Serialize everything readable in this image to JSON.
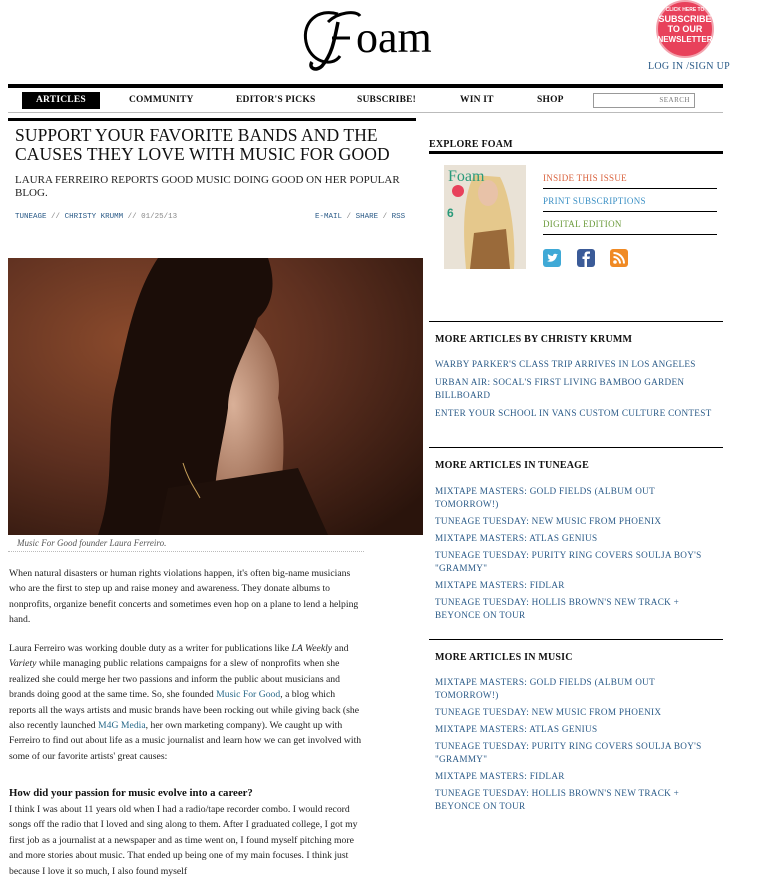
{
  "header": {
    "logo_text": "Foam",
    "newsletter_badge": [
      "CLICK HERE TO",
      "SUBSCRIBE",
      "TO OUR",
      "NEWSLETTER"
    ],
    "login_label": "LOG IN /SIGN UP"
  },
  "nav": {
    "items": [
      "ARTICLES",
      "COMMUNITY",
      "EDITOR'S PICKS",
      "SUBSCRIBE!",
      "WIN IT",
      "SHOP"
    ],
    "search_label": "SEARCH"
  },
  "article": {
    "title": "SUPPORT YOUR FAVORITE BANDS AND THE CAUSES THEY LOVE WITH MUSIC FOR GOOD",
    "subtitle": "LAURA FERREIRO REPORTS GOOD MUSIC DOING GOOD ON HER POPULAR BLOG.",
    "meta": {
      "category": "TUNEAGE",
      "author": "CHRISTY KRUMM",
      "date": "01/25/13",
      "sep": "//"
    },
    "actions": {
      "email": "E-MAIL",
      "share": "SHARE",
      "rss": "RSS",
      "sep": "/"
    },
    "caption": "Music For Good founder Laura Ferreiro.",
    "para1": "When natural disasters or human rights violations happen, it's often big-name musicians who are the first to step up and raise money and awareness. They donate albums to nonprofits, organize benefit concerts and sometimes even hop on a plane to lend a helping hand.",
    "para2": {
      "t1": "Laura Ferreiro was working double duty as a writer for publications like ",
      "i1": "LA Weekly",
      "t2": " and ",
      "i2": "Variety",
      "t3": " while managing public relations campaigns for a slew of nonprofits when she realized she could merge her two passions and inform the public about musicians and brands doing good at the same time. So, she founded ",
      "link1": "Music For Good",
      "t4": ", a blog which reports all the ways artists and music brands have been rocking out while giving back (she also recently launched ",
      "link2": "M4G Media",
      "t5": ", her own marketing company). We caught up with Ferreiro to find out about life as a music journalist and learn how we can get involved with some of our favorite artists' great causes:"
    },
    "question1": "How did your passion for music evolve into a career?",
    "answer1": "I think I was about 11 years old when I had a radio/tape recorder combo. I would record songs off the radio that I loved and sing along to them. After I graduated college, I got my first job as a journalist at a newspaper and as time went on, I found myself pitching more and more stories about music. That ended up being one of my main focuses. I think just because I love it so much, I also found myself"
  },
  "sidebar": {
    "explore_label": "EXPLORE FOAM",
    "cover": {
      "logo": "Foam",
      "badge": "6"
    },
    "links": [
      {
        "label": "INSIDE THIS ISSUE",
        "color": "#d9603b"
      },
      {
        "label": "PRINT SUBSCRIPTIONS",
        "color": "#3a8fc4"
      },
      {
        "label": "DIGITAL EDITION",
        "color": "#6a9a3a"
      }
    ],
    "social": [
      "twitter-icon",
      "facebook-icon",
      "rss-icon"
    ],
    "sections": [
      {
        "title": "MORE ARTICLES BY CHRISTY KRUMM",
        "items": [
          "WARBY PARKER'S CLASS TRIP ARRIVES IN LOS ANGELES",
          "URBAN AIR: SOCAL'S FIRST LIVING BAMBOO GARDEN BILLBOARD",
          "ENTER YOUR SCHOOL IN VANS CUSTOM CULTURE CONTEST"
        ]
      },
      {
        "title": "MORE ARTICLES IN TUNEAGE",
        "items": [
          "MIXTAPE MASTERS: GOLD FIELDS (ALBUM OUT TOMORROW!)",
          "TUNEAGE TUESDAY: NEW MUSIC FROM PHOENIX",
          "MIXTAPE MASTERS: ATLAS GENIUS",
          "TUNEAGE TUESDAY: PURITY RING COVERS SOULJA BOY'S \"GRAMMY\"",
          "MIXTAPE MASTERS: FIDLAR",
          "TUNEAGE TUESDAY: HOLLIS BROWN'S NEW TRACK + BEYONCE ON TOUR"
        ]
      },
      {
        "title": "MORE ARTICLES IN MUSIC",
        "items": [
          "MIXTAPE MASTERS: GOLD FIELDS (ALBUM OUT TOMORROW!)",
          "TUNEAGE TUESDAY: NEW MUSIC FROM PHOENIX",
          "MIXTAPE MASTERS: ATLAS GENIUS",
          "TUNEAGE TUESDAY: PURITY RING COVERS SOULJA BOY'S \"GRAMMY\"",
          "MIXTAPE MASTERS: FIDLAR",
          "TUNEAGE TUESDAY: HOLLIS BROWN'S NEW TRACK + BEYONCE ON TOUR"
        ]
      }
    ]
  }
}
